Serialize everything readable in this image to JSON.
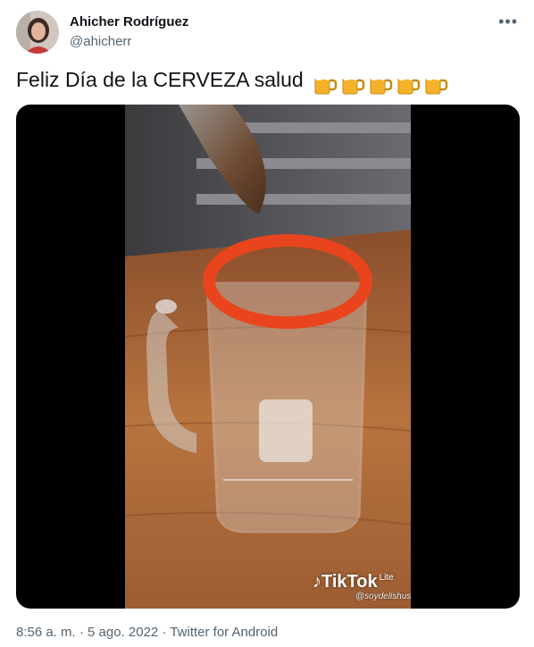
{
  "tweet": {
    "author_name": "Ahicher Rodríguez",
    "author_handle": "@ahicherr",
    "more_label": "•••",
    "text": "Feliz Día de la CERVEZA salud",
    "emoji_icons": [
      "beer-mug-icon",
      "beer-mug-icon",
      "beer-mug-icon",
      "beer-mug-icon",
      "beer-mug-icon"
    ],
    "media": {
      "watermark_brand": "TikTok",
      "watermark_badge": "Lite",
      "watermark_user": "@soydelishus"
    },
    "timestamp": "8:56 a. m. · 5 ago. 2022 · Twitter for Android"
  },
  "colors": {
    "text_primary": "#0f1419",
    "text_secondary": "#536471",
    "rim_red": "#e8451f"
  }
}
